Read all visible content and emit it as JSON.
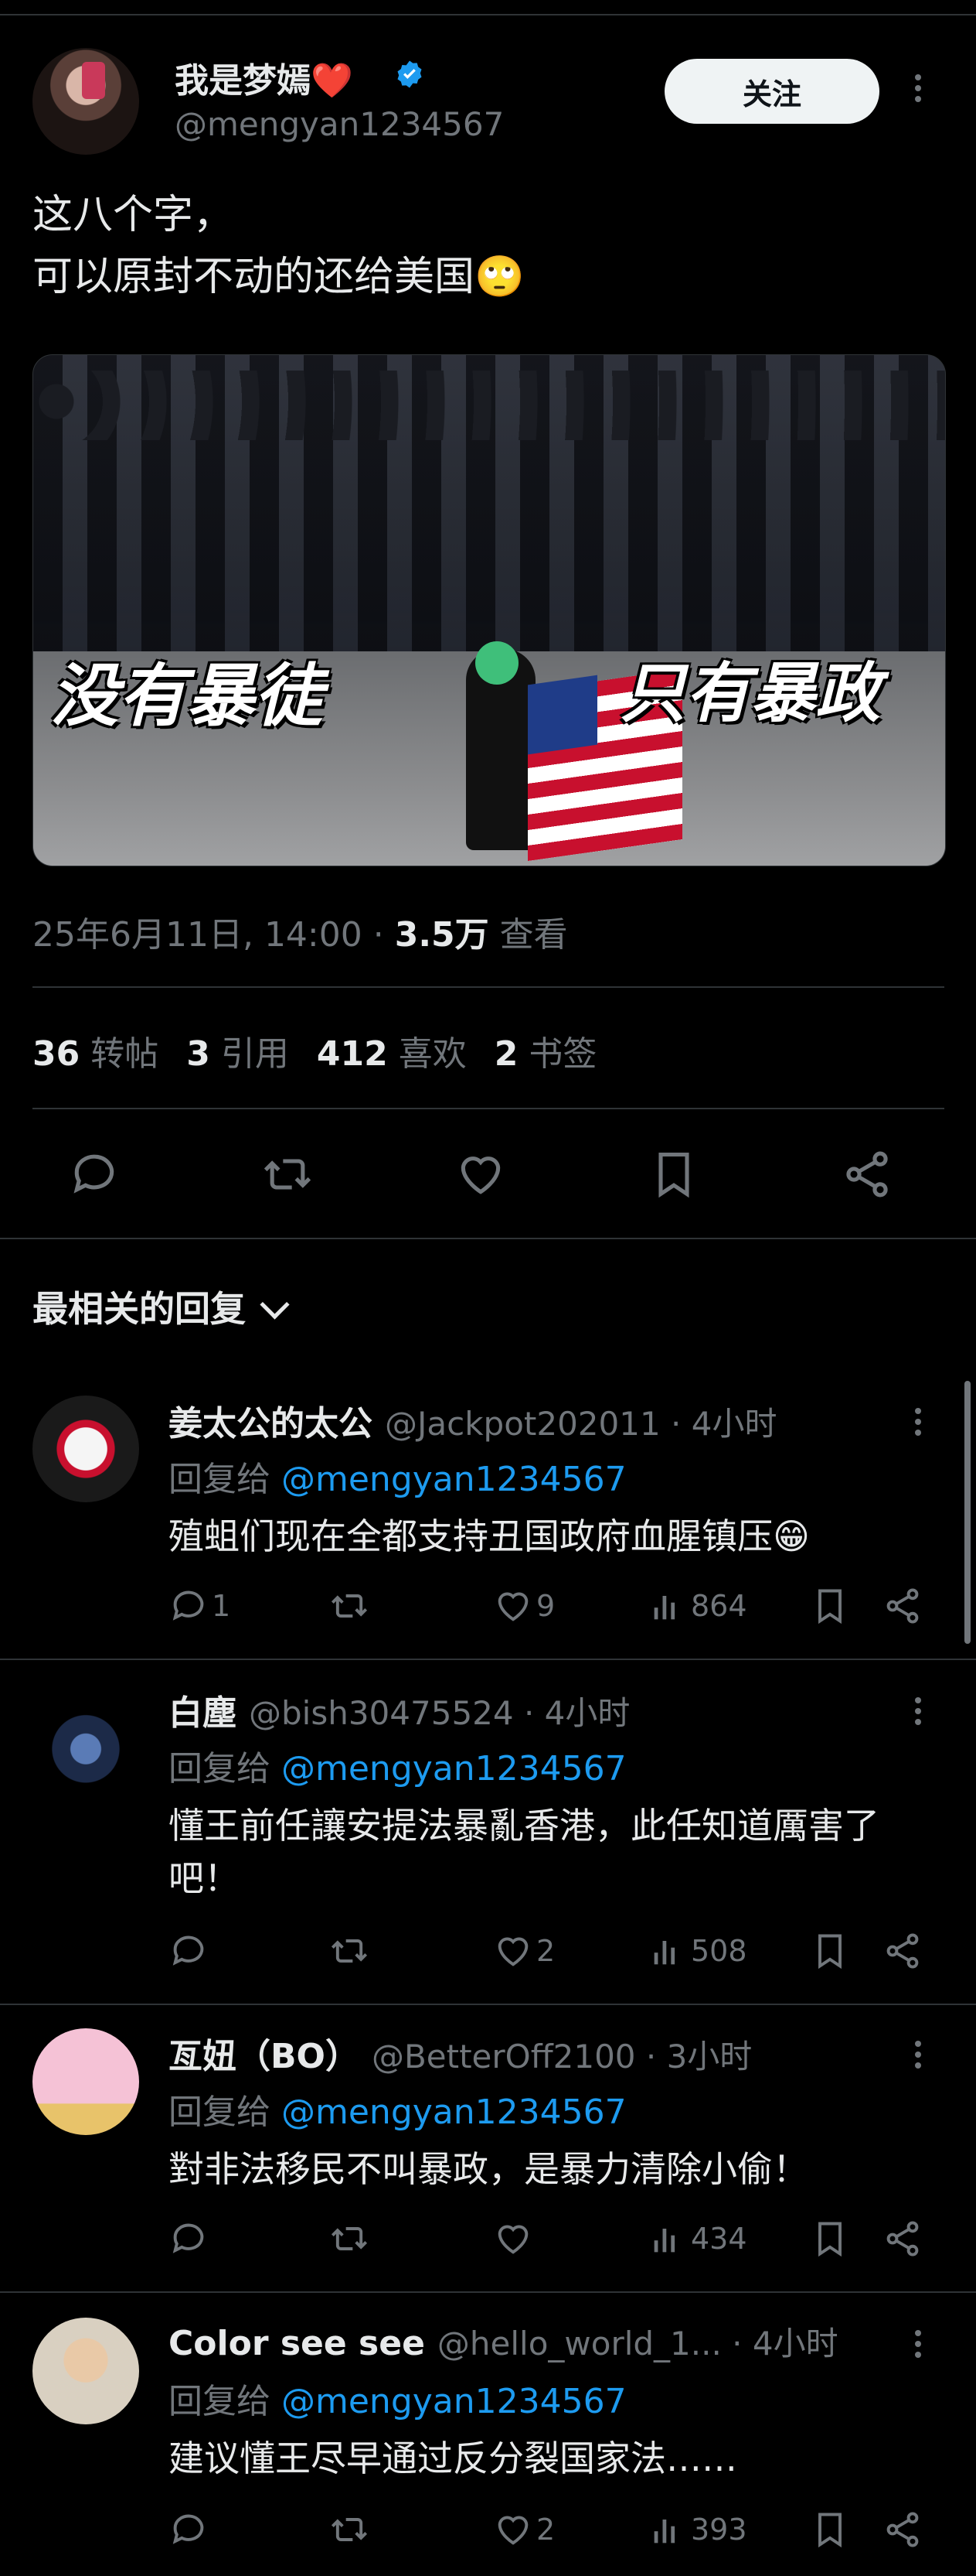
{
  "tweet": {
    "author_name": "我是梦嫣",
    "heart": "❤️",
    "author_handle": "@mengyan1234567",
    "follow_label": "关注",
    "text": "这八个字，\n可以原封不动的还给美国🙄",
    "media": {
      "caption_left": "没有暴徒",
      "caption_right": "只有暴政"
    },
    "timestamp": "25年6月11日, 14:00 · ",
    "views_count": "3.5万",
    "views_label": " 查看",
    "stats": {
      "retweets_count": "36",
      "retweets_label": " 转帖",
      "quotes_count": "3",
      "quotes_label": " 引用",
      "likes_count": "412",
      "likes_label": " 喜欢",
      "bookmarks_count": "2",
      "bookmarks_label": " 书签"
    }
  },
  "sort": {
    "label": "最相关的回复"
  },
  "replies": [
    {
      "name": "姜太公的太公",
      "handle": "@Jackpot202011 · 4小时",
      "replying_prefix": "回复给 ",
      "replying_to": "@mengyan1234567",
      "text": "殖蛆们现在全都支持丑国政府血腥镇压😁",
      "reply_count": "1",
      "retweet_count": "",
      "like_count": "9",
      "view_count": "864"
    },
    {
      "name": "白塵",
      "handle": "@bish30475524 · 4小时",
      "replying_prefix": "回复给 ",
      "replying_to": "@mengyan1234567",
      "text": "懂王前任讓安提法暴亂香港，此任知道厲害了吧！",
      "reply_count": "",
      "retweet_count": "",
      "like_count": "2",
      "view_count": "508"
    },
    {
      "name": "亙妞（BO）",
      "handle": "@BetterOff2100 · 3小时",
      "replying_prefix": "回复给 ",
      "replying_to": "@mengyan1234567",
      "text": "對非法移民不叫暴政，是暴力清除小偷！",
      "reply_count": "",
      "retweet_count": "",
      "like_count": "",
      "view_count": "434"
    },
    {
      "name": "Color see see",
      "handle": "@hello_world_1... · 4小时",
      "replying_prefix": "回复给 ",
      "replying_to": "@mengyan1234567",
      "text": "建议懂王尽早通过反分裂国家法……",
      "reply_count": "",
      "retweet_count": "",
      "like_count": "2",
      "view_count": "393"
    }
  ],
  "colors": {
    "background": "#000000",
    "accent": "#1d9bf0",
    "muted": "#71767b",
    "text": "#e7e9ea",
    "heart": "#f4212e"
  }
}
